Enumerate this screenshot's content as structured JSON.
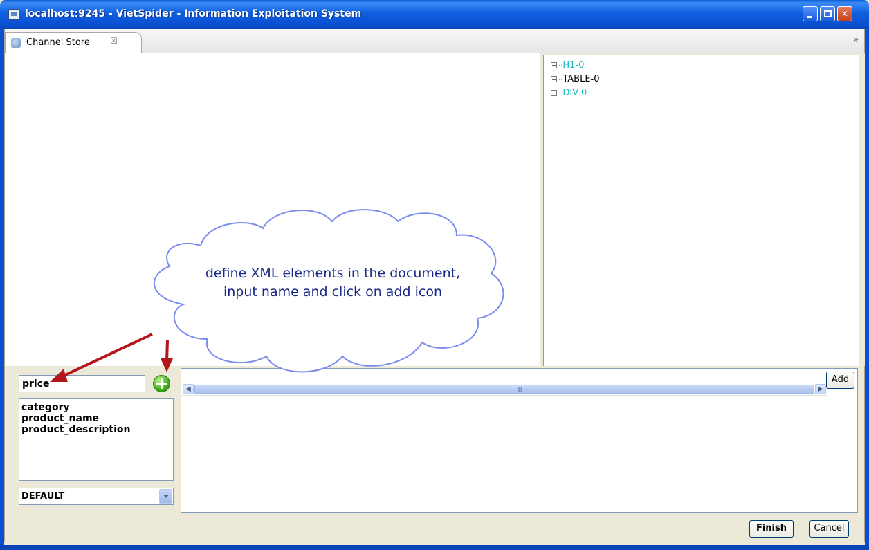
{
  "window": {
    "title": "localhost:9245 - VietSpider - Information Exploitation System"
  },
  "tab": {
    "label": "Channel Store",
    "close_glyph": "☒",
    "overflow_glyph": "»"
  },
  "tree": {
    "items": [
      {
        "label": "H1-0",
        "color": "#19bcc0"
      },
      {
        "label": "TABLE-0",
        "color": "#000000"
      },
      {
        "label": "DIV-0",
        "color": "#19bcc0"
      }
    ]
  },
  "annotation": {
    "text": "define XML elements in the document, input name and click on add icon"
  },
  "form": {
    "name_value": "price",
    "elements": [
      "category",
      "product_name",
      "product_description"
    ],
    "mode_selected": "DEFAULT"
  },
  "buttons": {
    "add_label": "Add",
    "finish_label": "Finish",
    "cancel_label": "Cancel"
  },
  "scrollbar": {
    "grip": "IIII"
  },
  "colors": {
    "titlebar": "#0a4fd0",
    "tree_link": "#19bcc0",
    "annotation_text": "#1a2a8a",
    "arrow": "#c0161b"
  }
}
